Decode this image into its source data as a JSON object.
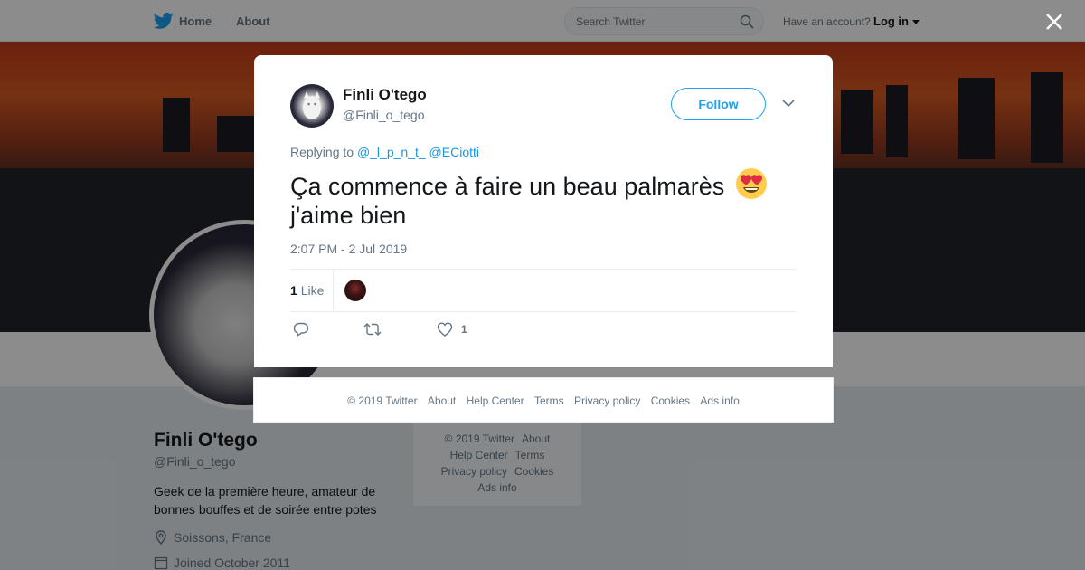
{
  "nav": {
    "home_label": "Home",
    "about_label": "About",
    "search_placeholder": "Search Twitter",
    "have_account": "Have an account?",
    "login_label": "Log in"
  },
  "profile": {
    "name": "Finli O'tego",
    "handle": "@Finli_o_tego",
    "bio": "Geek de la première heure, amateur de bonnes bouffes et de soirée entre potes",
    "location": "Soissons, France",
    "joined": "Joined October 2011"
  },
  "side_footer": {
    "copyright": "© 2019 Twitter",
    "about": "About",
    "help": "Help Center",
    "terms": "Terms",
    "privacy": "Privacy policy",
    "cookies": "Cookies",
    "ads": "Ads info"
  },
  "tweet": {
    "author_name": "Finli O'tego",
    "author_handle": "@Finli_o_tego",
    "follow_label": "Follow",
    "replying_prefix": "Replying to",
    "reply_to_1": "@_l_p_n_t_",
    "reply_to_2": "@ECiotti",
    "text_line1": "Ça commence à faire un beau palmarès",
    "text_line2": "j'aime bien",
    "emoji": "heart-eyes-emoji",
    "timestamp": "2:07 PM - 2 Jul 2019",
    "like_count": "1",
    "like_word": "Like",
    "action_like_count": "1"
  },
  "modal_footer": {
    "copyright": "© 2019 Twitter",
    "about": "About",
    "help": "Help Center",
    "terms": "Terms",
    "privacy": "Privacy policy",
    "cookies": "Cookies",
    "ads": "Ads info"
  },
  "colors": {
    "brand": "#1da1f2",
    "link": "#1b95e0",
    "muted": "#657786"
  }
}
